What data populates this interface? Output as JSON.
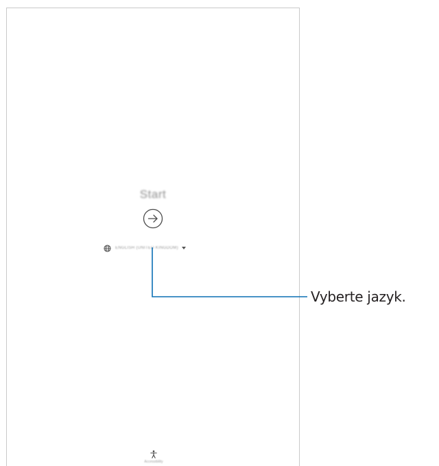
{
  "screen": {
    "start_label": "Start",
    "start_button_icon": "arrow-right-circle-icon",
    "language": {
      "icon": "globe-icon",
      "label": "ENGLISH (UNITED KINGDOM)",
      "dropdown_icon": "chevron-down-icon"
    },
    "accessibility": {
      "icon": "accessibility-icon",
      "label": "Accessibility"
    }
  },
  "callout": {
    "text": "Vyberte jazyk.",
    "line_color": "#0a6eb4"
  },
  "colors": {
    "screen_border": "#c9c9c9",
    "muted_text": "#8e8e8e",
    "callout_text": "#231f20"
  }
}
